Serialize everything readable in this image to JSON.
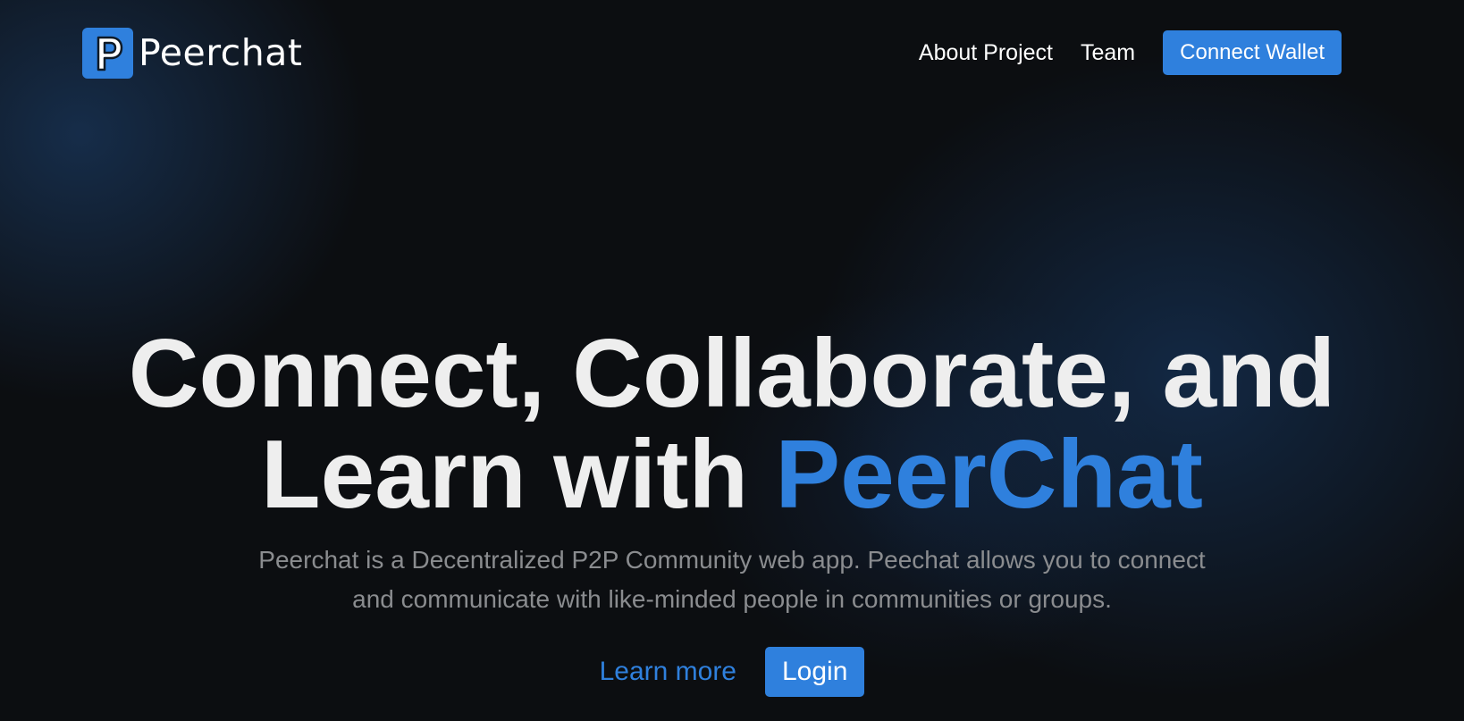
{
  "brand": {
    "logo_letter": "P",
    "name": "Peerchat",
    "accent_color": "#2f80dd"
  },
  "nav": {
    "links": [
      "About Project",
      "Team"
    ],
    "connect_wallet_label": "Connect Wallet"
  },
  "hero": {
    "headline_line1": "Connect, Collaborate, and",
    "headline_line2_prefix": "Learn with ",
    "headline_line2_accent": "PeerChat",
    "description": "Peerchat is a Decentralized P2P Community web app. Peechat allows you to connect and communicate with like-minded people in communities or groups.",
    "learn_more_label": "Learn more",
    "login_label": "Login"
  }
}
